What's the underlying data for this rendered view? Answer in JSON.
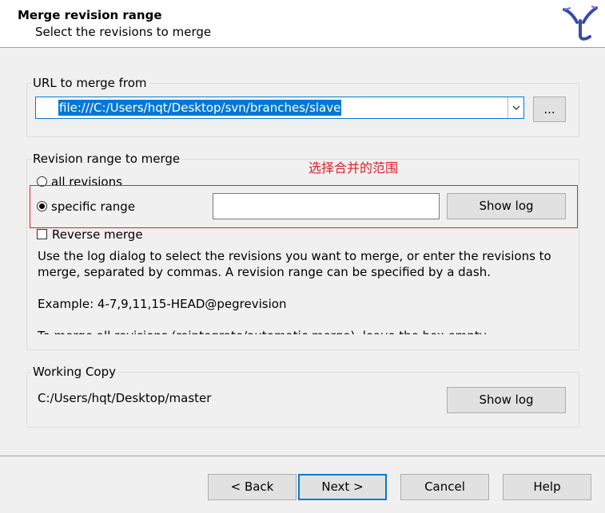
{
  "header": {
    "title": "Merge revision range",
    "subtitle": "Select the revisions to merge"
  },
  "url_group": {
    "label": "URL to merge from",
    "url_value": "file:///C:/Users/hqt/Desktop/svn/branches/slave",
    "browse_label": "..."
  },
  "revision_group": {
    "label": "Revision range to merge",
    "all_revisions_label": "all revisions",
    "specific_range_label": "specific range",
    "selected": "specific range",
    "range_value": "",
    "show_log_label": "Show log",
    "reverse_merge_label": "Reverse merge",
    "reverse_merge_checked": false,
    "help_text": "Use the log dialog to select the revisions you want to merge, or enter the revisions to merge, separated by commas. A revision range can be specified by a dash.",
    "example_text": "Example: 4-7,9,11,15-HEAD@pegrevision",
    "truncated_text": "To merge all revisions (reintegrate/automatic merge), leave the box empty."
  },
  "annotation": {
    "text": "选择合并的范围",
    "color": "#e0202a"
  },
  "working_copy": {
    "label": "Working Copy",
    "path": "C:/Users/hqt/Desktop/master",
    "show_log_label": "Show log"
  },
  "footer": {
    "back_label": "< Back",
    "next_label": "Next >",
    "cancel_label": "Cancel",
    "help_label": "Help"
  },
  "colors": {
    "accent": "#0078d7",
    "annotation": "#e0202a"
  }
}
